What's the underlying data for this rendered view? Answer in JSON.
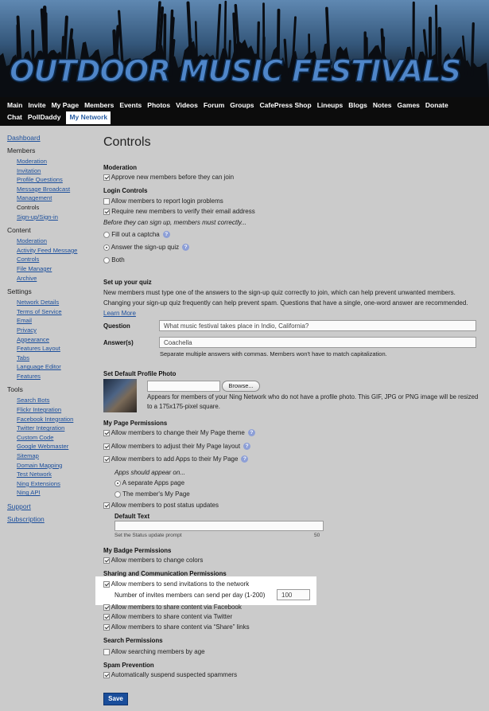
{
  "site": {
    "title": "OUTDOOR MUSIC FESTIVALS"
  },
  "nav": {
    "row1": [
      "Main",
      "Invite",
      "My Page",
      "Members",
      "Events",
      "Photos",
      "Videos",
      "Forum",
      "Groups",
      "CafePress Shop",
      "Lineups",
      "Blogs",
      "Notes",
      "Games",
      "Donate"
    ],
    "row2": [
      "Chat",
      "PollDaddy",
      "My Network"
    ],
    "active": "My Network"
  },
  "sidebar": {
    "dashboard": "Dashboard",
    "members": {
      "heading": "Members",
      "items": [
        "Moderation",
        "Invitation",
        "Profile Questions",
        "Message Broadcast",
        "Management",
        "Controls",
        "Sign-up/Sign-in"
      ]
    },
    "content": {
      "heading": "Content",
      "items": [
        "Moderation",
        "Activity Feed Message",
        "Controls",
        "File Manager",
        "Archive"
      ]
    },
    "settings": {
      "heading": "Settings",
      "items": [
        "Network Details",
        "Terms of Service",
        "Email",
        "Privacy",
        "Appearance",
        "Features Layout",
        "Tabs",
        "Language Editor",
        "Features"
      ]
    },
    "tools": {
      "heading": "Tools",
      "items": [
        "Search Bots",
        "Flickr Integration",
        "Facebook Integration",
        "Twitter Integration",
        "Custom Code",
        "Google Webmaster",
        "Sitemap",
        "Domain Mapping",
        "Test Network",
        "Ning Extensions",
        "Ning API"
      ]
    },
    "support": "Support",
    "subscription": "Subscription"
  },
  "page": {
    "title": "Controls",
    "moderation": {
      "heading": "Moderation",
      "approve": "Approve new members before they can join"
    },
    "login": {
      "heading": "Login Controls",
      "report": "Allow members to report login problems",
      "verify": "Require new members to verify their email address",
      "before": "Before they can sign up, members must correctly...",
      "captcha": "Fill out a captcha",
      "quiz": "Answer the sign-up quiz",
      "both": "Both"
    },
    "quiz": {
      "heading": "Set up your quiz",
      "desc1": "New members must type one of the answers to the sign-up quiz correctly to join, which can help prevent unwanted members. Changing your sign-up quiz frequently can help prevent spam. Questions that have a single, one-word answer are recommended.",
      "learn_more": "Learn More",
      "question_label": "Question",
      "question_value": "What music festival takes place in Indio, California?",
      "answers_label": "Answer(s)",
      "answers_value": "Coachella",
      "answers_hint": "Separate multiple answers with commas. Members won't have to match capitalization."
    },
    "photo": {
      "heading": "Set Default Profile Photo",
      "browse": "Browse...",
      "desc": "Appears for members of your Ning Network who do not have a profile photo. This GIF, JPG or PNG image will be resized to a 175x175-pixel square."
    },
    "mypage": {
      "heading": "My Page Permissions",
      "theme": "Allow members to change their My Page theme",
      "layout": "Allow members to adjust their My Page layout",
      "apps": "Allow members to add Apps to their My Page",
      "appear": "Apps should appear on...",
      "separate": "A separate Apps page",
      "members_page": "The member's My Page",
      "status": "Allow members to post status updates",
      "default_text_label": "Default Text",
      "status_hint": "Set the Status update prompt",
      "char_limit": "50"
    },
    "badge": {
      "heading": "My Badge Permissions",
      "colors": "Allow members to change colors"
    },
    "sharing": {
      "heading": "Sharing and Communication Permissions",
      "invites": "Allow members to send invitations to the network",
      "invites_per_day_label": "Number of invites members can send per day (1-200)",
      "invites_per_day": "100",
      "facebook": "Allow members to share content via Facebook",
      "twitter": "Allow members to share content via Twitter",
      "share_links": "Allow members to share content via “Share” links"
    },
    "search": {
      "heading": "Search Permissions",
      "age": "Allow searching members by age"
    },
    "spam": {
      "heading": "Spam Prevention",
      "suspend": "Automatically suspend suspected spammers"
    },
    "save": "Save"
  }
}
